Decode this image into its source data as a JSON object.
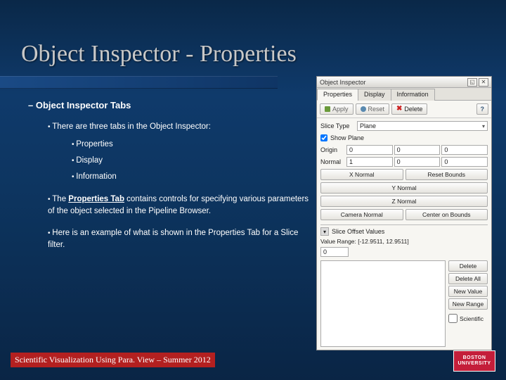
{
  "title": "Object Inspector - Properties",
  "content": {
    "heading": "Object Inspector Tabs",
    "intro": "There are three tabs in the Object Inspector:",
    "tabs": [
      "Properties",
      "Display",
      "Information"
    ],
    "para2_pre": "The ",
    "para2_bold": "Properties Tab",
    "para2_post": " contains controls for specifying various parameters of the object selected in the Pipeline Browser.",
    "para3": "Here is an example of what is shown in the Properties Tab for a Slice filter."
  },
  "footer": "Scientific Visualization Using Para. View – Summer 2012",
  "logo": {
    "l1": "BOSTON",
    "l2": "UNIVERSITY"
  },
  "panel": {
    "title": "Object Inspector",
    "tab_properties": "Properties",
    "tab_display": "Display",
    "tab_information": "Information",
    "apply": "Apply",
    "reset": "Reset",
    "delete": "Delete",
    "help": "?",
    "slice_type_label": "Slice Type",
    "slice_type_value": "Plane",
    "show_plane": "Show Plane",
    "origin_label": "Origin",
    "origin": [
      "0",
      "0",
      "0"
    ],
    "normal_label": "Normal",
    "normal": [
      "1",
      "0",
      "0"
    ],
    "xnormal": "X Normal",
    "ynormal": "Y Normal",
    "znormal": "Z Normal",
    "camnormal": "Camera Normal",
    "resetbounds": "Reset Bounds",
    "centerbounds": "Center on Bounds",
    "slice_section": "Slice Offset Values",
    "value_range": "Value Range: [-12.9511, 12.9511]",
    "value0": "0",
    "btn_delete": "Delete",
    "btn_delete_all": "Delete All",
    "btn_new_value": "New Value",
    "btn_new_range": "New Range",
    "scientific": "Scientific"
  }
}
